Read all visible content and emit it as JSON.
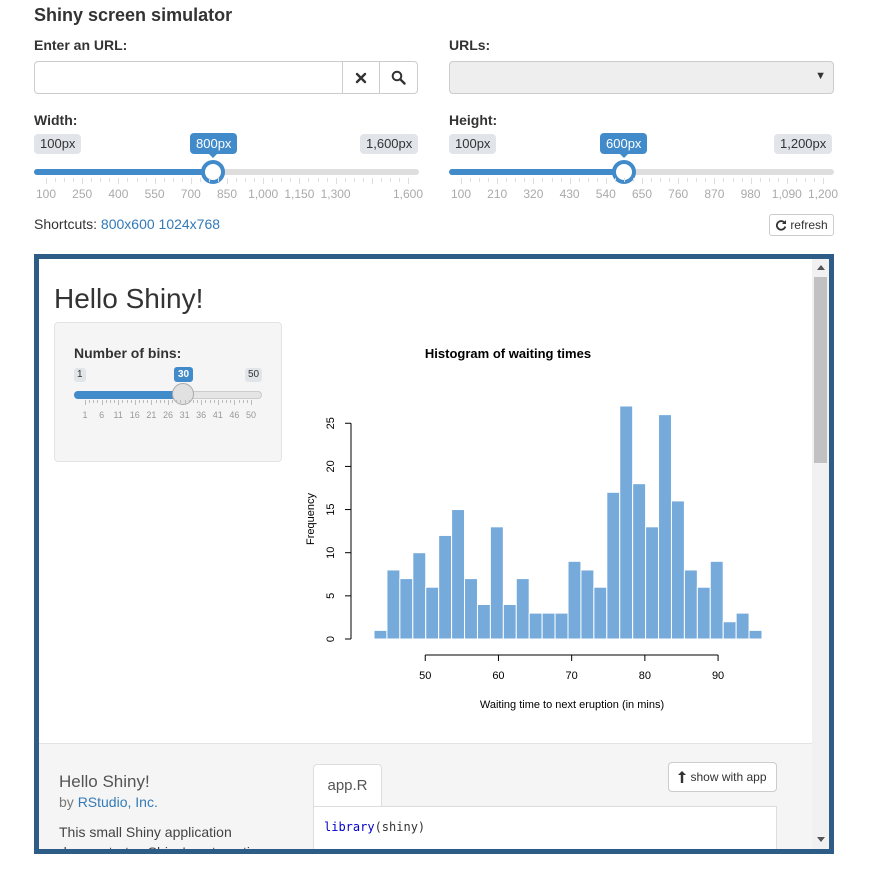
{
  "app": {
    "title": "Shiny screen simulator"
  },
  "url": {
    "label": "Enter an URL:",
    "value": "",
    "placeholder": ""
  },
  "urls": {
    "label": "URLs:",
    "selected": ""
  },
  "width_slider": {
    "label": "Width:",
    "min_label": "100px",
    "max_label": "1,600px",
    "value_label": "800px",
    "min": 100,
    "max": 1600,
    "value": 800,
    "ticks": [
      "100",
      "250",
      "400",
      "550",
      "700",
      "850",
      "1,000",
      "1,150",
      "1,300",
      "",
      "1,600"
    ]
  },
  "height_slider": {
    "label": "Height:",
    "min_label": "100px",
    "max_label": "1,200px",
    "value_label": "600px",
    "min": 100,
    "max": 1200,
    "value": 600,
    "ticks": [
      "100",
      "210",
      "320",
      "430",
      "540",
      "650",
      "760",
      "870",
      "980",
      "1,090",
      "1,200"
    ]
  },
  "shortcuts": {
    "label": "Shortcuts:",
    "items": [
      "800x600",
      "1024x768"
    ]
  },
  "refresh": {
    "label": "refresh"
  },
  "preview": {
    "title": "Hello Shiny!",
    "bins": {
      "label": "Number of bins:",
      "min_label": "1",
      "max_label": "50",
      "value_label": "30",
      "min": 1,
      "max": 50,
      "value": 30,
      "ticks": [
        "1",
        "6",
        "11",
        "16",
        "21",
        "26",
        "31",
        "36",
        "41",
        "46",
        "50"
      ]
    },
    "about": {
      "title": "Hello Shiny!",
      "by": "by",
      "author": "RStudio, Inc.",
      "description": "This small Shiny application demonstrates Shiny's automatic UI",
      "tab": "app.R",
      "show_app": "show with app",
      "code_fn": "library",
      "code_arg": "(shiny)"
    }
  },
  "chart_data": {
    "type": "bar",
    "title": "Histogram of waiting times",
    "xlabel": "Waiting time to next eruption (in mins)",
    "ylabel": "Frequency",
    "bin_start": 43,
    "bin_width": 1.7667,
    "values": [
      1,
      8,
      7,
      10,
      6,
      12,
      15,
      7,
      4,
      13,
      4,
      7,
      3,
      3,
      3,
      9,
      8,
      6,
      17,
      27,
      18,
      13,
      26,
      16,
      8,
      6,
      9,
      2,
      3,
      1
    ],
    "x_ticks": [
      50,
      60,
      70,
      80,
      90
    ],
    "y_ticks": [
      0,
      5,
      10,
      15,
      20,
      25
    ],
    "xlim": [
      43,
      96
    ],
    "ylim": [
      0,
      27
    ],
    "bar_color": "#75AADB"
  }
}
